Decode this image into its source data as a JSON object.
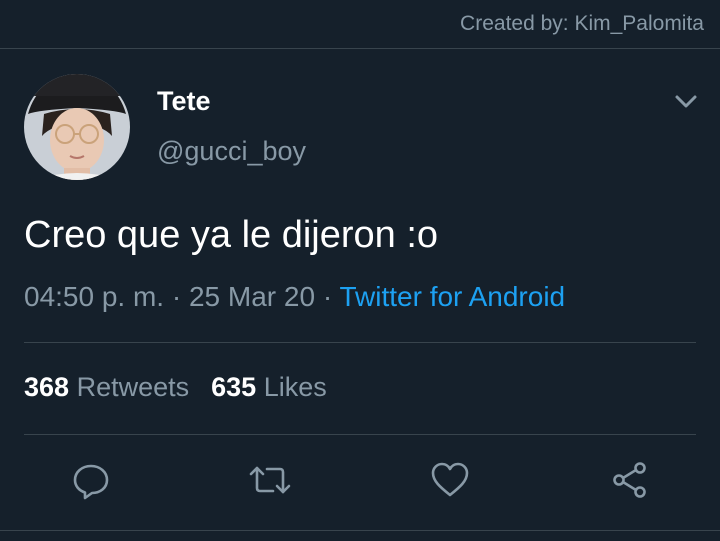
{
  "header": {
    "credit": "Created by: Kim_Palomita"
  },
  "tweet": {
    "author_name": "Tete",
    "author_handle": "@gucci_boy",
    "text": "Creo que ya le dijeron :o",
    "time": "04:50 p. m.",
    "separator": " · ",
    "date": "25 Mar 20",
    "source": "Twitter for Android"
  },
  "stats": {
    "retweets_count": "368",
    "retweets_label": "Retweets",
    "likes_count": "635",
    "likes_label": "Likes"
  },
  "actions": {
    "icons": [
      "reply-icon",
      "retweet-icon",
      "like-icon",
      "share-icon"
    ]
  },
  "colors": {
    "background": "#15202b",
    "secondary_text": "#8899a6",
    "link": "#1da1f2",
    "divider": "#38444d"
  }
}
